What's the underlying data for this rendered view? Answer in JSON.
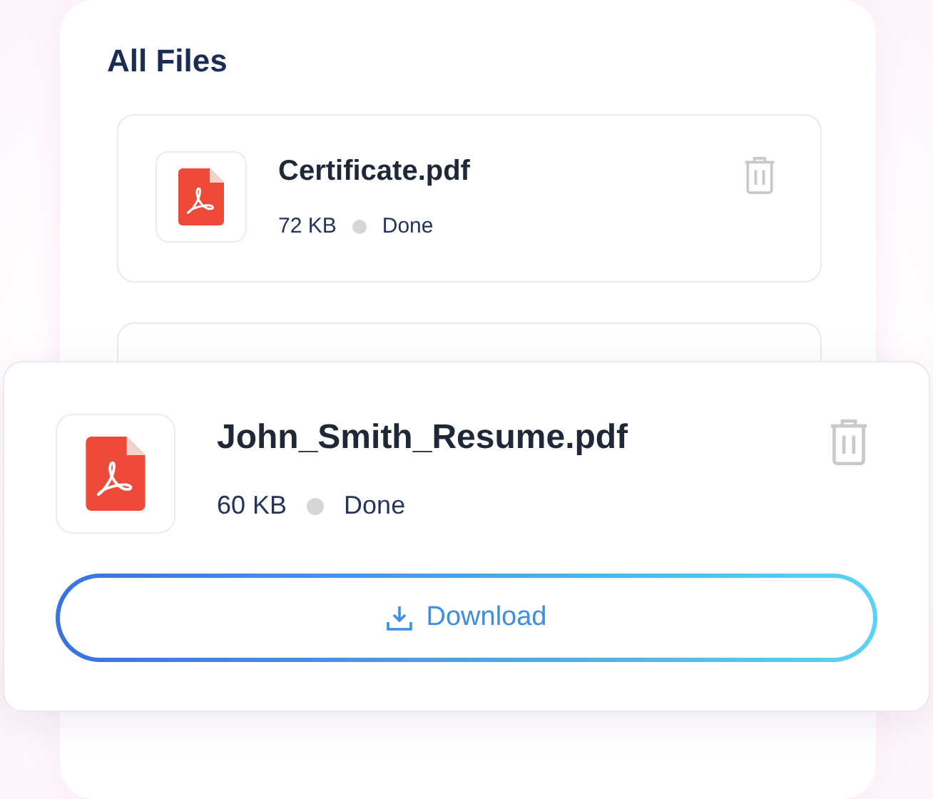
{
  "title": "All Files",
  "files": [
    {
      "name": "Certificate.pdf",
      "size": "72 KB",
      "status": "Done"
    }
  ],
  "popup": {
    "name": "John_Smith_Resume.pdf",
    "size": "60 KB",
    "status": "Done",
    "button": "Download"
  }
}
